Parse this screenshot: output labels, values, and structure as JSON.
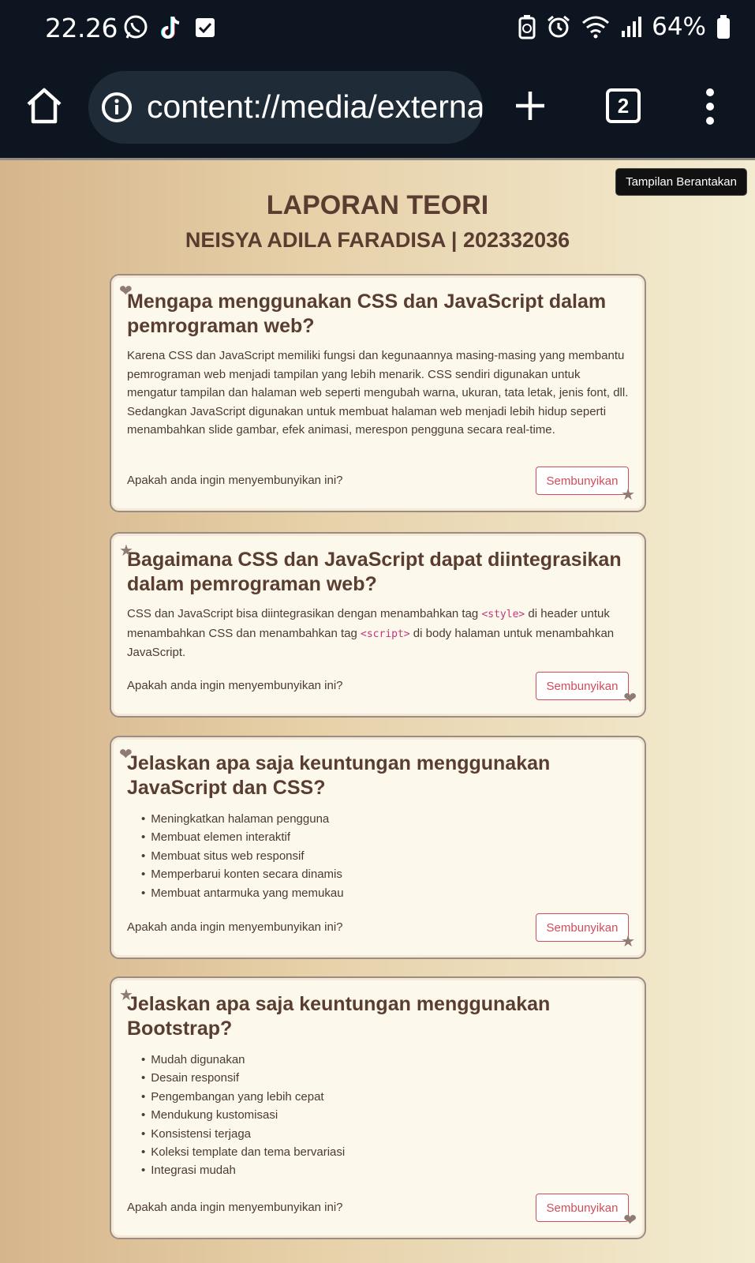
{
  "status_bar": {
    "time": "22.26",
    "battery": "64%",
    "left_icons": [
      "whatsapp-icon",
      "tiktok-icon",
      "checkbox-icon"
    ],
    "right_icons": [
      "battery-saver-icon",
      "alarm-icon",
      "wifi-icon",
      "signal-icon",
      "battery-icon"
    ]
  },
  "browser": {
    "url": "content://media/external",
    "tab_count": "2"
  },
  "tooltip": "Tampilan Berantakan",
  "header": {
    "title": "LAPORAN TEORI",
    "subtitle": "NEISYA ADILA FARADISA | 202332036"
  },
  "cards": [
    {
      "question": "Mengapa menggunakan CSS dan JavaScript dalam pemrograman web?",
      "answer": "Karena CSS dan JavaScript memiliki fungsi dan kegunaannya masing-masing yang membantu pemrograman web menjadi tampilan yang lebih menarik. CSS sendiri digunakan untuk mengatur tampilan dan halaman web seperti mengubah warna, ukuran, tata letak, jenis font, dll. Sedangkan JavaScript digunakan untuk membuat halaman web menjadi lebih hidup seperti menambahkan slide gambar, efek animasi, merespon pengguna secara real-time.",
      "prompt": "Apakah anda ingin menyembunyikan ini?",
      "button": "Sembunyikan"
    },
    {
      "question": "Bagaimana CSS dan JavaScript dapat diintegrasikan dalam pemrograman web?",
      "answer_parts": {
        "p1": "CSS dan JavaScript bisa diintegrasikan dengan menambahkan tag ",
        "code1": "<style>",
        "p2": " di header untuk menambahkan CSS dan menambahkan tag ",
        "code2": "<script>",
        "p3": " di body halaman untuk menambahkan JavaScript."
      },
      "prompt": "Apakah anda ingin menyembunyikan ini?",
      "button": "Sembunyikan"
    },
    {
      "question": "Jelaskan apa saja keuntungan menggunakan JavaScript dan CSS?",
      "items": [
        "Meningkatkan halaman pengguna",
        "Membuat elemen interaktif",
        "Membuat situs web responsif",
        "Memperbarui konten secara dinamis",
        "Membuat antarmuka yang memukau"
      ],
      "prompt": "Apakah anda ingin menyembunyikan ini?",
      "button": "Sembunyikan"
    },
    {
      "question": "Jelaskan apa saja keuntungan menggunakan Bootstrap?",
      "items": [
        "Mudah digunakan",
        "Desain responsif",
        "Pengembangan yang lebih cepat",
        "Mendukung kustomisasi",
        "Konsistensi terjaga",
        "Koleksi template dan tema bervariasi",
        "Integrasi mudah"
      ],
      "prompt": "Apakah anda ingin menyembunyikan ini?",
      "button": "Sembunyikan"
    }
  ]
}
